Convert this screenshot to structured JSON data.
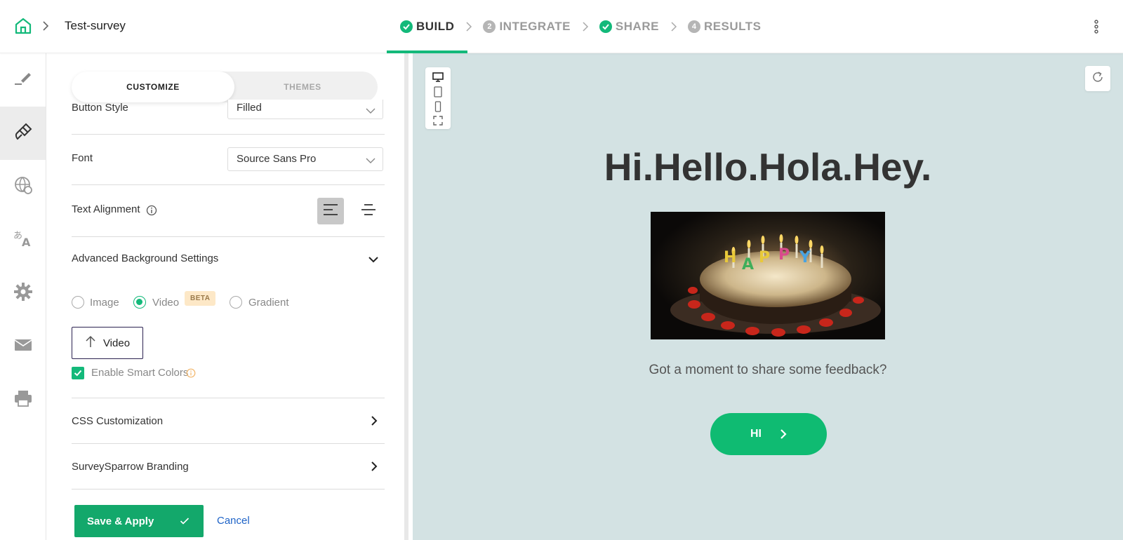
{
  "header": {
    "survey_name": "Test-survey",
    "steps": [
      {
        "label": "BUILD",
        "badge": "check",
        "active": true
      },
      {
        "label": "INTEGRATE",
        "badge": "2",
        "active": false
      },
      {
        "label": "SHARE",
        "badge": "check",
        "active": false
      },
      {
        "label": "RESULTS",
        "badge": "4",
        "active": false
      }
    ]
  },
  "rail": {
    "items": [
      "pencil-icon",
      "paint-brush-icon",
      "globe-icon",
      "translate-icon",
      "gear-icon",
      "mail-icon",
      "print-icon"
    ],
    "active_index": 1
  },
  "panel": {
    "tabs": {
      "customize": "CUSTOMIZE",
      "themes": "THEMES"
    },
    "button_style": {
      "label": "Button Style",
      "value": "Filled"
    },
    "font": {
      "label": "Font",
      "value": "Source Sans Pro"
    },
    "text_alignment": {
      "label": "Text Alignment",
      "selected": "left"
    },
    "advanced_bg": {
      "label": "Advanced Background Settings",
      "options": [
        "Image",
        "Video",
        "Gradient"
      ],
      "selected": "Video",
      "beta": "BETA",
      "upload_label": "Video",
      "smart_colors": {
        "label": "Enable Smart Colors",
        "checked": true
      }
    },
    "css_customization": "CSS Customization",
    "branding": "SurveySparrow Branding",
    "save_label": "Save & Apply",
    "cancel_label": "Cancel"
  },
  "preview": {
    "title": "Hi.Hello.Hola.Hey.",
    "subtitle": "Got a moment to share some feedback?",
    "button_label": "HI",
    "image_letters": [
      "H",
      "A",
      "P",
      "P",
      "Y"
    ]
  },
  "colors": {
    "accent": "#13b97a",
    "preview_bg": "#d3e2e3",
    "link": "#1e63c7"
  }
}
